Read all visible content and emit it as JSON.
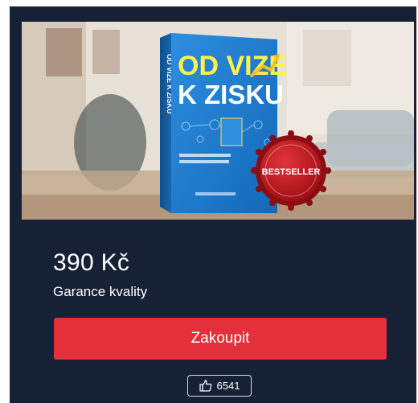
{
  "product": {
    "image": {
      "book_title_line1": "OD VIZE",
      "book_title_line2": "K ZISKU",
      "spine_text": "OD VIZE K ZISKU",
      "badge_text": "BESTSELLER"
    },
    "price": "390 Kč",
    "guarantee": "Garance kvality",
    "buy_label": "Zakoupit",
    "likes": "6541"
  },
  "colors": {
    "card_bg": "#172136",
    "button_red": "#e3303a",
    "badge_red": "#c3161d"
  },
  "icons": {
    "like": "thumbs-up-icon"
  }
}
